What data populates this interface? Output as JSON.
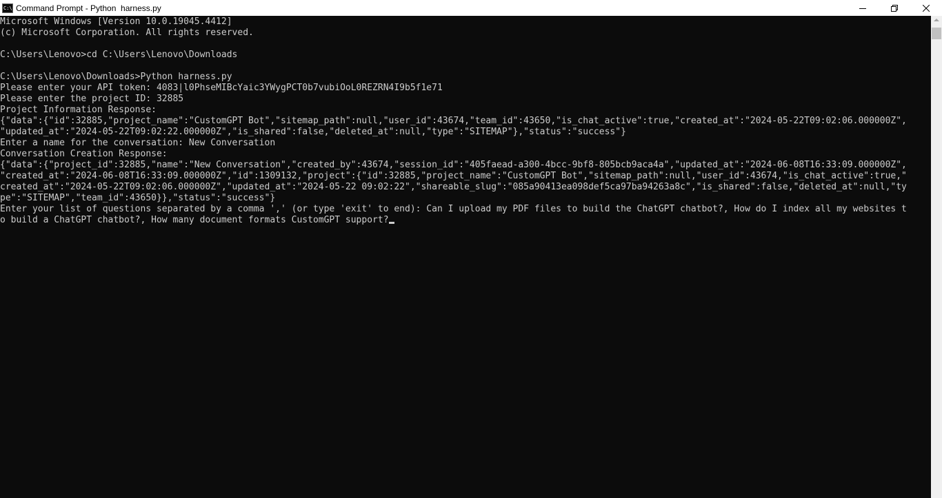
{
  "window": {
    "title": "Command Prompt - Python  harness.py",
    "app_icon": "cmd-icon",
    "buttons": {
      "minimize": "minimize-icon",
      "maximize": "restore-icon",
      "close": "close-icon"
    }
  },
  "colors": {
    "console_bg": "#0c0c0c",
    "console_fg": "#cccccc",
    "titlebar_bg": "#ffffff"
  },
  "console": {
    "lines": [
      "Microsoft Windows [Version 10.0.19045.4412]",
      "(c) Microsoft Corporation. All rights reserved.",
      "",
      "C:\\Users\\Lenovo>cd C:\\Users\\Lenovo\\Downloads",
      "",
      "C:\\Users\\Lenovo\\Downloads>Python harness.py",
      "Please enter your API token: 4083|l0PhseMIBcYaic3YWygPCT0b7vubiOoL0REZRN4I9b5f1e71",
      "Please enter the project ID: 32885",
      "Project Information Response:",
      "{\"data\":{\"id\":32885,\"project_name\":\"CustomGPT Bot\",\"sitemap_path\":null,\"user_id\":43674,\"team_id\":43650,\"is_chat_active\":true,\"created_at\":\"2024-05-22T09:02:06.000000Z\",",
      "\"updated_at\":\"2024-05-22T09:02:22.000000Z\",\"is_shared\":false,\"deleted_at\":null,\"type\":\"SITEMAP\"},\"status\":\"success\"}",
      "Enter a name for the conversation: New Conversation",
      "Conversation Creation Response:",
      "{\"data\":{\"project_id\":32885,\"name\":\"New Conversation\",\"created_by\":43674,\"session_id\":\"405faead-a300-4bcc-9bf8-805bcb9aca4a\",\"updated_at\":\"2024-06-08T16:33:09.000000Z\",",
      "\"created_at\":\"2024-06-08T16:33:09.000000Z\",\"id\":1309132,\"project\":{\"id\":32885,\"project_name\":\"CustomGPT Bot\",\"sitemap_path\":null,\"user_id\":43674,\"is_chat_active\":true,\"",
      "created_at\":\"2024-05-22T09:02:06.000000Z\",\"updated_at\":\"2024-05-22 09:02:22\",\"shareable_slug\":\"085a90413ea098def5ca97ba94263a8c\",\"is_shared\":false,\"deleted_at\":null,\"ty",
      "pe\":\"SITEMAP\",\"team_id\":43650}},\"status\":\"success\"}",
      "Enter your list of questions separated by a comma ',' (or type 'exit' to end): Can I upload my PDF files to build the ChatGPT chatbot?, How do I index all my websites t",
      "o build a ChatGPT chatbot?, How many document formats CustomGPT support?"
    ]
  }
}
